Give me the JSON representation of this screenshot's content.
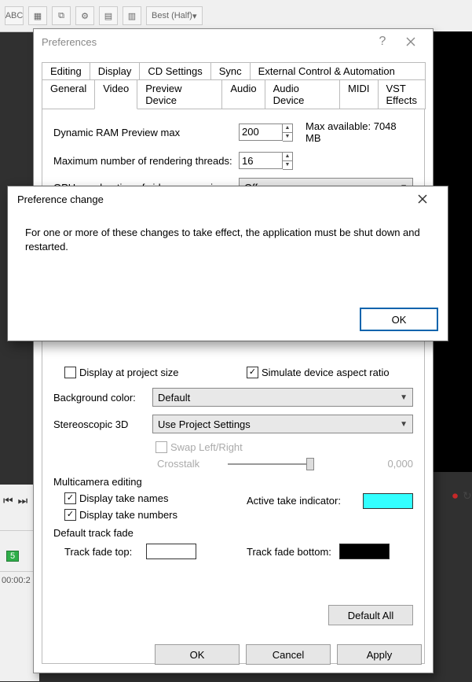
{
  "toolbar": {
    "best_label": "Best (Half)"
  },
  "prefs": {
    "title": "Preferences",
    "tabs_row1": [
      "Editing",
      "Display",
      "CD Settings",
      "Sync",
      "External Control & Automation"
    ],
    "tabs_row2": [
      "General",
      "Video",
      "Preview Device",
      "Audio",
      "Audio Device",
      "MIDI",
      "VST Effects"
    ],
    "active_tab": "Video",
    "ram_label": "Dynamic RAM Preview max",
    "ram_value": "200",
    "max_available": "Max available: 7048 MB",
    "threads_label": "Maximum number of rendering threads:",
    "threads_value": "16",
    "gpu_label": "GPU acceleration of video processing:",
    "gpu_value": "Off",
    "display_at_project_size": "Display at project size",
    "simulate_aspect": "Simulate device aspect ratio",
    "simulate_aspect_checked": true,
    "bg_label": "Background color:",
    "bg_value": "Default",
    "stereo_label": "Stereoscopic 3D",
    "stereo_value": "Use Project Settings",
    "swap_lr": "Swap Left/Right",
    "crosstalk_label": "Crosstalk",
    "crosstalk_value": "0,000",
    "multicam": {
      "legend": "Multicamera editing",
      "take_names": "Display take names",
      "take_names_checked": true,
      "take_numbers": "Display take numbers",
      "take_numbers_checked": true,
      "indicator_label": "Active take indicator:",
      "indicator_color": "#33FFFF"
    },
    "default_fade": {
      "legend": "Default track fade",
      "top_label": "Track fade top:",
      "top_color": "#FFFFFF",
      "bottom_label": "Track fade bottom:",
      "bottom_color": "#000000"
    },
    "default_all": "Default All",
    "ok": "OK",
    "cancel": "Cancel",
    "apply": "Apply"
  },
  "modal": {
    "title": "Preference change",
    "message": "For one or more of these changes to take effect, the application must be shut down and restarted.",
    "ok": "OK"
  },
  "marker": "5",
  "timecode": "00:00:2",
  "right_transport": {
    "refresh": "↻",
    "power": "⏻",
    "next": "⏭"
  }
}
